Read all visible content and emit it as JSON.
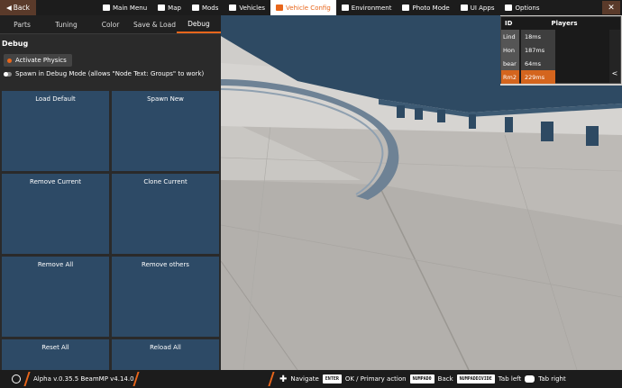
{
  "topbar": {
    "back_label": "Back",
    "nav_items": [
      {
        "label": "Main Menu",
        "icon": "menu-icon"
      },
      {
        "label": "Map",
        "icon": "map-icon"
      },
      {
        "label": "Mods",
        "icon": "mods-icon"
      },
      {
        "label": "Vehicles",
        "icon": "car-icon"
      },
      {
        "label": "Vehicle Config",
        "icon": "vehicle-config-icon",
        "active": true
      },
      {
        "label": "Environment",
        "icon": "cloud-icon"
      },
      {
        "label": "Photo Mode",
        "icon": "camera-icon"
      },
      {
        "label": "UI Apps",
        "icon": "apps-icon"
      },
      {
        "label": "Options",
        "icon": "gear-icon"
      }
    ],
    "close_label": "✕"
  },
  "subtabs": [
    "Parts",
    "Tuning",
    "Color",
    "Save & Load",
    "Debug"
  ],
  "active_subtab": "Debug",
  "panel": {
    "title": "Debug",
    "activate_physics": "Activate Physics",
    "spawn_debug": "Spawn in Debug Mode (allows \"Node Text: Groups\" to work)",
    "buttons": [
      "Load Default",
      "Spawn New",
      "Remove Current",
      "Clone Current",
      "Remove All",
      "Remove others",
      "Reset All",
      "Reload All"
    ]
  },
  "players": {
    "header_id": "ID",
    "header_players": "Players",
    "rows": [
      {
        "name": "Lind",
        "ping": "18ms"
      },
      {
        "name": "Hon",
        "ping": "187ms"
      },
      {
        "name": "bear",
        "ping": "64ms"
      },
      {
        "name": "Rm2",
        "ping": "229ms",
        "highlight": true
      }
    ],
    "collapse_glyph": "<"
  },
  "bottombar": {
    "version": "Alpha v.0.35.5  BeamMP v4.14.0",
    "hints": [
      {
        "type": "dpad",
        "label": "Navigate"
      },
      {
        "type": "key",
        "key": "ENTER",
        "label": "OK / Primary action"
      },
      {
        "type": "key",
        "key": "NUMPAD0",
        "label": "Back"
      },
      {
        "type": "key",
        "key": "NUMPADDIVIDE",
        "label": "Tab left"
      },
      {
        "type": "gamepad",
        "label": "Tab right"
      }
    ]
  },
  "colors": {
    "accent": "#e8661b",
    "button_blue": "#2d4a66",
    "panel": "#2a2a2a"
  }
}
